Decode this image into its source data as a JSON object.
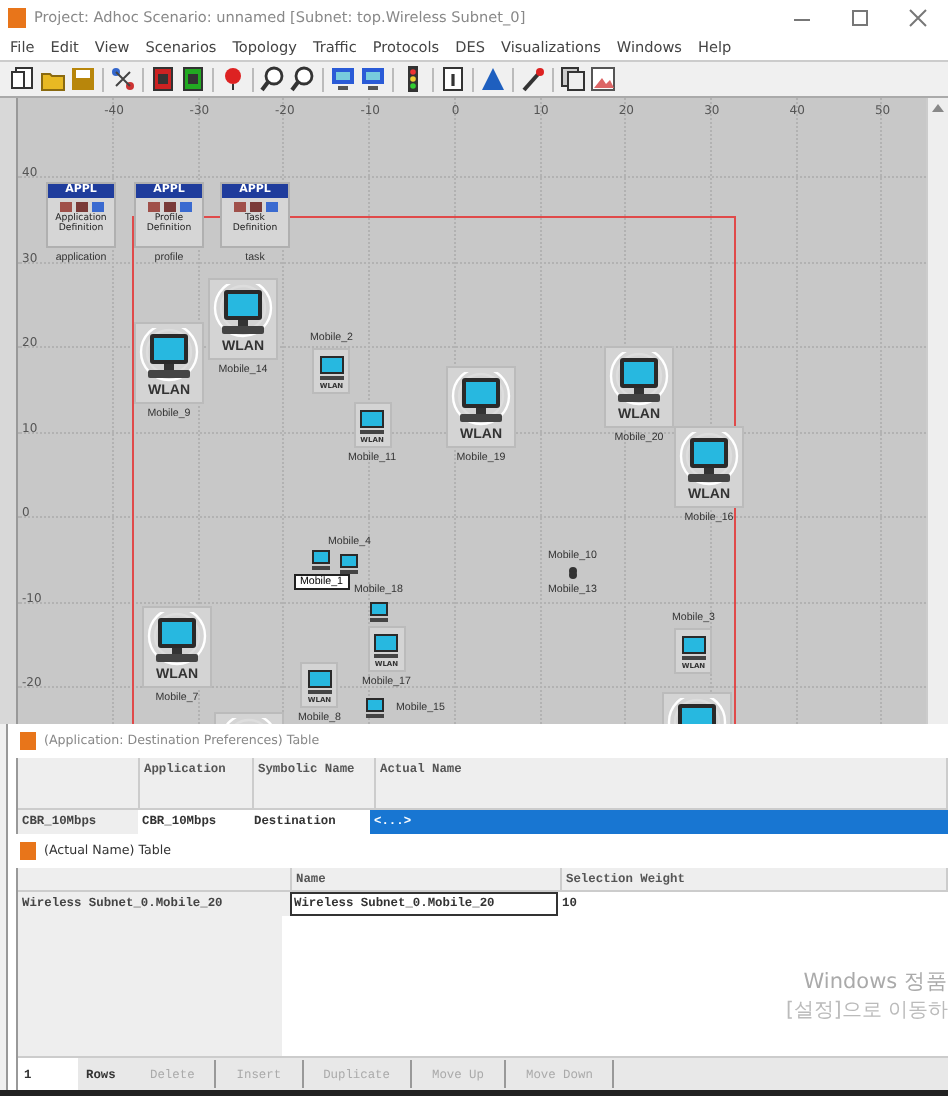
{
  "window": {
    "title": "Project: Adhoc Scenario: unnamed  [Subnet: top.Wireless Subnet_0]"
  },
  "menu": [
    "File",
    "Edit",
    "View",
    "Scenarios",
    "Topology",
    "Traffic",
    "Protocols",
    "DES",
    "Visualizations",
    "Windows",
    "Help"
  ],
  "canvas": {
    "x_ticks": [
      "-40",
      "-30",
      "-20",
      "-10",
      "0",
      "10",
      "20",
      "30",
      "40",
      "50"
    ],
    "y_ticks": [
      "40",
      "30",
      "20",
      "10",
      "0",
      "-10",
      "-20"
    ],
    "nodes": [
      {
        "kind": "appl",
        "badge": "APPL",
        "caption": "Application Definition",
        "label": "application",
        "selected": false
      },
      {
        "kind": "appl",
        "badge": "APPL",
        "caption": "Profile Definition",
        "label": "profile",
        "selected": false
      },
      {
        "kind": "appl",
        "badge": "APPL",
        "caption": "Task Definition",
        "label": "task",
        "selected": false
      },
      {
        "kind": "wlan_large",
        "badge": "WLAN",
        "label": "Mobile_9",
        "selected": false
      },
      {
        "kind": "wlan_large",
        "badge": "WLAN",
        "label": "Mobile_14",
        "selected": false
      },
      {
        "kind": "wlan_small",
        "badge": "WLAN",
        "label": "Mobile_2",
        "selected": false
      },
      {
        "kind": "wlan_small",
        "badge": "WLAN",
        "label": "Mobile_11",
        "selected": false
      },
      {
        "kind": "wlan_large",
        "badge": "WLAN",
        "label": "Mobile_19",
        "selected": false
      },
      {
        "kind": "wlan_large",
        "badge": "WLAN",
        "label": "Mobile_20",
        "selected": false
      },
      {
        "kind": "wlan_large",
        "badge": "WLAN",
        "label": "Mobile_16",
        "selected": false
      },
      {
        "kind": "wlan_tiny",
        "label": "Mobile_4",
        "selected": false
      },
      {
        "kind": "wlan_tiny",
        "label": "Mobile_1",
        "selected": true
      },
      {
        "kind": "dot",
        "label": "Mobile_10",
        "selected": false
      },
      {
        "kind": "dot",
        "label": "Mobile_13",
        "selected": false
      },
      {
        "kind": "wlan_tiny",
        "label": "Mobile_18",
        "selected": false
      },
      {
        "kind": "wlan_large",
        "badge": "WLAN",
        "label": "Mobile_7",
        "selected": false
      },
      {
        "kind": "wlan_small",
        "badge": "WLAN",
        "label": "Mobile_17",
        "selected": false
      },
      {
        "kind": "wlan_small",
        "badge": "WLAN",
        "label": "Mobile_3",
        "selected": false
      },
      {
        "kind": "wlan_small",
        "badge": "WLAN",
        "label": "Mobile_8",
        "selected": false
      },
      {
        "kind": "wlan_tiny",
        "label": "Mobile_15",
        "selected": false
      },
      {
        "kind": "wlan_partial"
      },
      {
        "kind": "wlan_partial"
      }
    ]
  },
  "tables": [
    {
      "title": "(Application: Destination Preferences) Table",
      "columns": [
        "",
        "Application",
        "Symbolic Name",
        "Actual Name"
      ],
      "rows": [
        {
          "cells": [
            {
              "text": "CBR_10Mbps",
              "selected": false,
              "focused": false
            },
            {
              "text": "CBR_10Mbps",
              "selected": false,
              "focused": false
            },
            {
              "text": "Destination",
              "selected": false,
              "focused": false
            },
            {
              "text": "<...>",
              "selected": true,
              "focused": false
            }
          ]
        }
      ]
    },
    {
      "title": "(Actual Name) Table",
      "columns": [
        "",
        "Name",
        "Selection Weight"
      ],
      "rows": [
        {
          "cells": [
            {
              "text": "Wireless Subnet_0.Mobile_20",
              "selected": false,
              "focused": false
            },
            {
              "text": "Wireless Subnet_0.Mobile_20",
              "selected": false,
              "focused": true
            },
            {
              "text": "10",
              "selected": false,
              "focused": false
            }
          ]
        }
      ],
      "row_count": "1",
      "rows_label": "Rows",
      "buttons": [
        {
          "label": "Delete",
          "disabled": true
        },
        {
          "label": "Insert",
          "disabled": true
        },
        {
          "label": "Duplicate",
          "disabled": true
        },
        {
          "label": "Move Up",
          "disabled": true
        },
        {
          "label": "Move Down",
          "disabled": true
        }
      ]
    }
  ],
  "os_notice": [
    "Windows 정품",
    "[설정]으로 이동하"
  ]
}
